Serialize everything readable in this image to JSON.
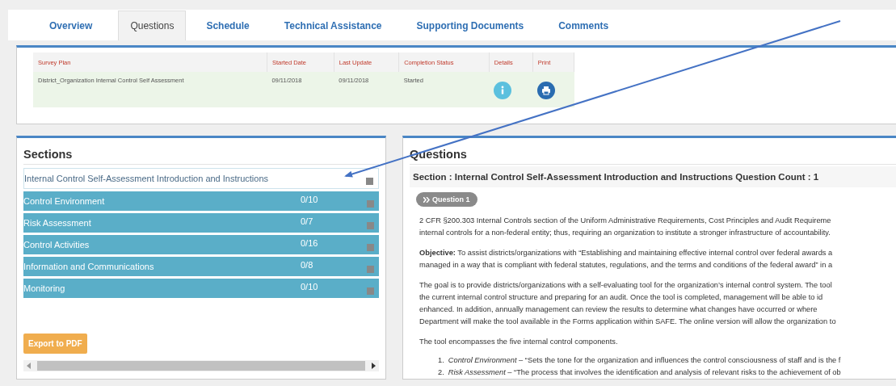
{
  "tabs": [
    {
      "label": "Overview",
      "selected": false
    },
    {
      "label": "Questions",
      "selected": true
    },
    {
      "label": "Schedule",
      "selected": false
    },
    {
      "label": "Technical Assistance",
      "selected": false
    },
    {
      "label": "Supporting Documents",
      "selected": false
    },
    {
      "label": "Comments",
      "selected": false
    }
  ],
  "survey_table": {
    "columns": [
      "Survey Plan",
      "Started Date",
      "Last Update",
      "Completion Status",
      "Details",
      "Print"
    ],
    "rows": [
      {
        "survey_plan": "District_Organization Internal Control Self Assessment",
        "started_date": "09/11/2018",
        "last_update": "09/11/2018",
        "completion_status": "Started"
      }
    ]
  },
  "sections": {
    "title": "Sections",
    "items": [
      {
        "label": "Internal Control Self-Assessment Introduction and Instructions",
        "selected": true
      },
      {
        "label": "Control Environment",
        "count": "0/10",
        "selected": false
      },
      {
        "label": "Risk Assessment",
        "count": "0/7",
        "selected": false
      },
      {
        "label": "Control Activities",
        "count": "0/16",
        "selected": false
      },
      {
        "label": "Information and Communications",
        "count": "0/8",
        "selected": false
      },
      {
        "label": "Monitoring",
        "count": "0/10",
        "selected": false
      }
    ],
    "export_button": "Export to PDF"
  },
  "questions": {
    "title": "Questions",
    "section_header": "Section : Internal Control Self-Assessment Introduction and Instructions Question Count : 1",
    "question_button": "Question 1",
    "paragraphs": [
      [
        "2 CFR §200.303 Internal Controls section of the Uniform Administrative Requirements, Cost Principles and Audit Requireme",
        "internal controls for a non-federal entity; thus, requiring an organization to institute a stronger infrastructure of accountability."
      ],
      [
        "**Objective:** To assist districts/organizations with “Establishing and maintaining effective internal control over federal awards a",
        "managed in a way that is compliant with federal statutes, regulations, and the terms and conditions of the federal award” in a"
      ],
      [
        "The goal is to provide districts/organizations with a self-evaluating tool for the organization’s internal control system. The tool",
        "the current internal control structure and preparing for an audit. Once the tool is completed, management will be able to id",
        "enhanced. In addition, annually management can review the results to determine what changes have occurred or where",
        "Department will make the tool available in the Forms application within SAFE. The online version will allow the organization to"
      ],
      [
        "The tool encompasses the five internal control components."
      ]
    ],
    "components": [
      {
        "number": "1.",
        "text": "*Control Environment* – “Sets the tone for the organization and influences the control consciousness of staff and is the f"
      },
      {
        "number": "2.",
        "text": "*Risk Assessment* – “The process that involves the identification and analysis of relevant risks to the achievement of ob"
      }
    ]
  }
}
